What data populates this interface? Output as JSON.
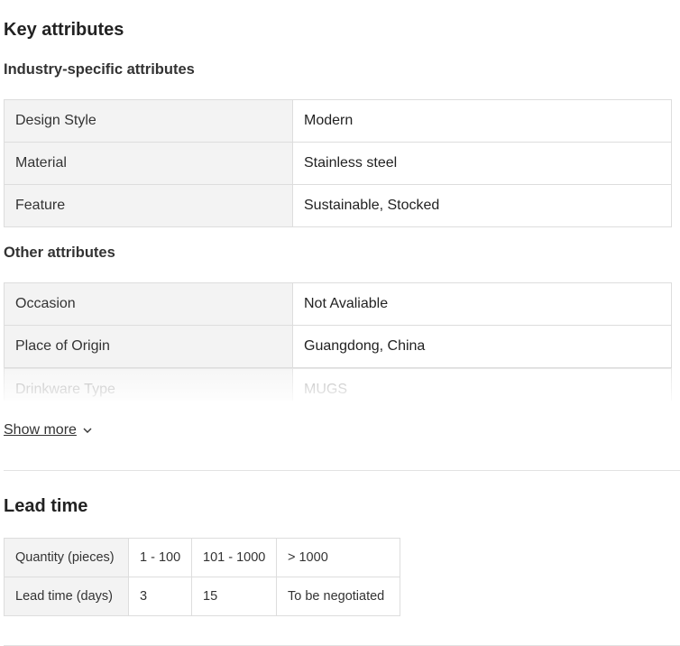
{
  "key_attributes": {
    "title": "Key attributes",
    "industry_title": "Industry-specific attributes",
    "industry_rows": [
      {
        "key": "Design Style",
        "value": "Modern"
      },
      {
        "key": "Material",
        "value": "Stainless steel"
      },
      {
        "key": "Feature",
        "value": "Sustainable, Stocked"
      }
    ],
    "other_title": "Other attributes",
    "other_rows": [
      {
        "key": "Occasion",
        "value": "Not Avaliable"
      },
      {
        "key": "Place of Origin",
        "value": "Guangdong, China"
      },
      {
        "key": "Drinkware Type",
        "value": "MUGS"
      }
    ],
    "show_more": "Show more"
  },
  "lead_time": {
    "title": "Lead time",
    "quantity_label": "Quantity (pieces)",
    "quantity_ranges": [
      "1 - 100",
      "101 - 1000",
      "> 1000"
    ],
    "days_label": "Lead time (days)",
    "days_values": [
      "3",
      "15",
      "To be negotiated"
    ]
  }
}
